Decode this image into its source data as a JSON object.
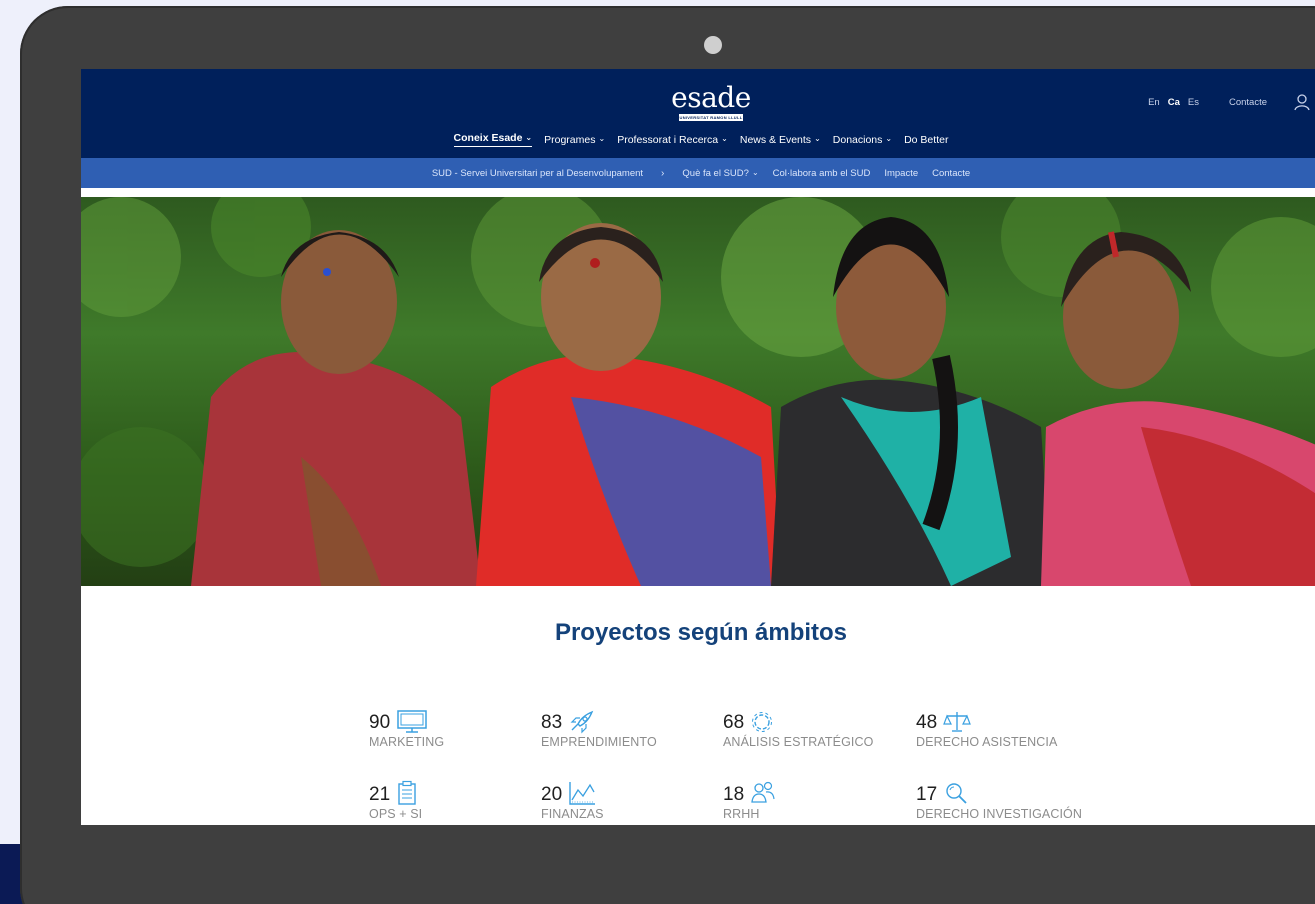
{
  "header": {
    "logo": {
      "word": "esade",
      "tagline": "UNIVERSITAT RAMON LLULL"
    },
    "languages": [
      {
        "label": "En",
        "active": false
      },
      {
        "label": "Ca",
        "active": true
      },
      {
        "label": "Es",
        "active": false
      }
    ],
    "contact_label": "Contacte",
    "user_icon": "user-icon",
    "nav": [
      {
        "label": "Coneix Esade",
        "dropdown": true,
        "active": true
      },
      {
        "label": "Programes",
        "dropdown": true,
        "active": false
      },
      {
        "label": "Professorat i Recerca",
        "dropdown": true,
        "active": false
      },
      {
        "label": "News & Events",
        "dropdown": true,
        "active": false
      },
      {
        "label": "Donacions",
        "dropdown": true,
        "active": false
      },
      {
        "label": "Do Better",
        "dropdown": false,
        "active": false
      }
    ]
  },
  "subnav": {
    "breadcrumb": "SUD - Servei Universitari per al Desenvolupament",
    "items": [
      {
        "label": "Què fa el SUD?",
        "dropdown": true
      },
      {
        "label": "Col·labora amb el SUD",
        "dropdown": false
      },
      {
        "label": "Impacte",
        "dropdown": false
      },
      {
        "label": "Contacte",
        "dropdown": false
      }
    ]
  },
  "hero": {
    "image": "photo-four-women-smiling"
  },
  "section": {
    "title": "Proyectos según ámbitos",
    "stats": [
      {
        "value": "90",
        "label": "MARKETING",
        "icon": "monitor-icon"
      },
      {
        "value": "83",
        "label": "EMPRENDIMIENTO",
        "icon": "rocket-icon"
      },
      {
        "value": "68",
        "label": "ANÁLISIS ESTRATÉGICO",
        "icon": "gear-icon"
      },
      {
        "value": "48",
        "label": "DERECHO ASISTENCIA",
        "icon": "scales-icon"
      },
      {
        "value": "21",
        "label": "OPS + SI",
        "icon": "clipboard-icon"
      },
      {
        "value": "20",
        "label": "FINANZAS",
        "icon": "chart-icon"
      },
      {
        "value": "18",
        "label": "RRHH",
        "icon": "people-icon"
      },
      {
        "value": "17",
        "label": "DERECHO INVESTIGACIÓN",
        "icon": "magnifier-icon"
      }
    ]
  },
  "colors": {
    "header_bg": "#00205b",
    "subnav_bg": "#2f5fb3",
    "title": "#14427a",
    "icon": "#3aa0e0"
  }
}
